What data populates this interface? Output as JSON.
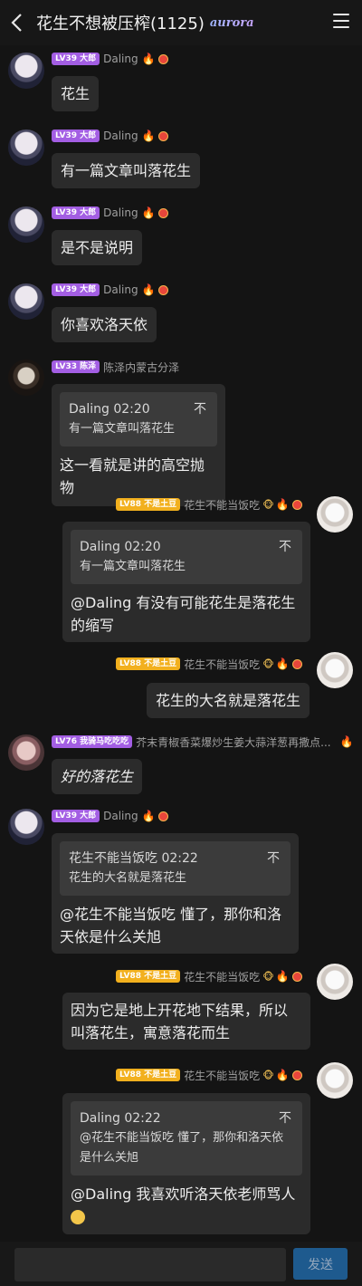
{
  "header": {
    "title": "花生不想被压榨(1125)",
    "badge": "aurora"
  },
  "users": {
    "daling": {
      "level": "LV39 大郎",
      "nick": "Daling"
    },
    "chenze": {
      "level": "LV33 陈泽",
      "nick": "陈泽内蒙古分泽"
    },
    "tudou": {
      "level": "LV88 不是土豆",
      "nick": "花生不能当饭吃"
    },
    "maqi": {
      "level": "LV76 我骑马吃吃吃",
      "nick": "芥末青椒香菜爆炒生姜大蒜洋葱再撒点..."
    }
  },
  "messages": [
    {
      "text": "花生"
    },
    {
      "text": "有一篇文章叫落花生"
    },
    {
      "text": "是不是说明"
    },
    {
      "text": "你喜欢洛天依"
    },
    {
      "quote_head": "Daling 02:20",
      "quote_text": "有一篇文章叫落花生",
      "line1": "这一看就是讲的高空抛物"
    },
    {
      "quote_head": "Daling 02:20",
      "quote_text": "有一篇文章叫落花生",
      "line1": "@Daling 有没有可能花生是落花生",
      "line2": "的缩写"
    },
    {
      "text": "花生的大名就是落花生"
    },
    {
      "text": "好的落花生"
    },
    {
      "quote_head": "花生不能当饭吃 02:22",
      "quote_text": "花生的大名就是落花生",
      "line1": "@花生不能当饭吃 懂了，那你和洛",
      "line2": "天依是什么关旭"
    },
    {
      "line1": "因为它是地上开花地下结果，所以",
      "line2": "叫落花生，寓意落花而生"
    },
    {
      "quote_head": "Daling 02:22",
      "quote_line1": "@花生不能当饭吃 懂了，那你和洛天依",
      "quote_line2": "是什么关旭",
      "line1": "@Daling 我喜欢听洛天依老师骂人"
    }
  ],
  "quote_pin_icon": "不",
  "composer": {
    "placeholder": "",
    "send_label": "发送"
  }
}
